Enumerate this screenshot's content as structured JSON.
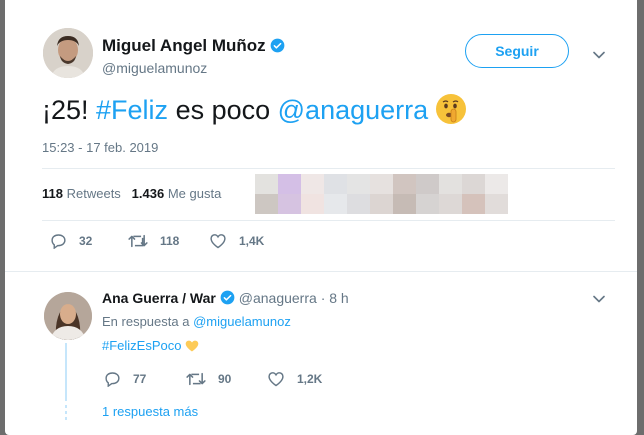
{
  "tweet": {
    "author_name": "Miguel Angel Muñoz",
    "author_handle": "@miguelamunoz",
    "follow_label": "Seguir",
    "text_prefix": "¡25! ",
    "hashtag": "#Feliz",
    "text_middle": " es poco ",
    "mention": "@anaguerra",
    "emoji": "shushing-face-emoji",
    "timestamp": "15:23 - 17 feb. 2019",
    "retweets_count": "118",
    "retweets_label": "Retweets",
    "likes_count": "1.436",
    "likes_label": "Me gusta",
    "actions": {
      "replies": "32",
      "retweets": "118",
      "likes": "1,4K"
    }
  },
  "reply": {
    "author_name": "Ana Guerra / War",
    "author_handle": "@anaguerra",
    "time": "· 8 h",
    "replying_prefix": "En respuesta a",
    "replying_to": "@miguelamunoz",
    "text": "#FelizEsPoco",
    "emoji": "yellow-heart-emoji",
    "actions": {
      "replies": "77",
      "retweets": "90",
      "likes": "1,2K"
    },
    "more_replies": "1 respuesta más"
  },
  "colors": {
    "link": "#1da1f2",
    "secondary_text": "#657786",
    "primary_text": "#14171a",
    "background": "#ffffff"
  }
}
